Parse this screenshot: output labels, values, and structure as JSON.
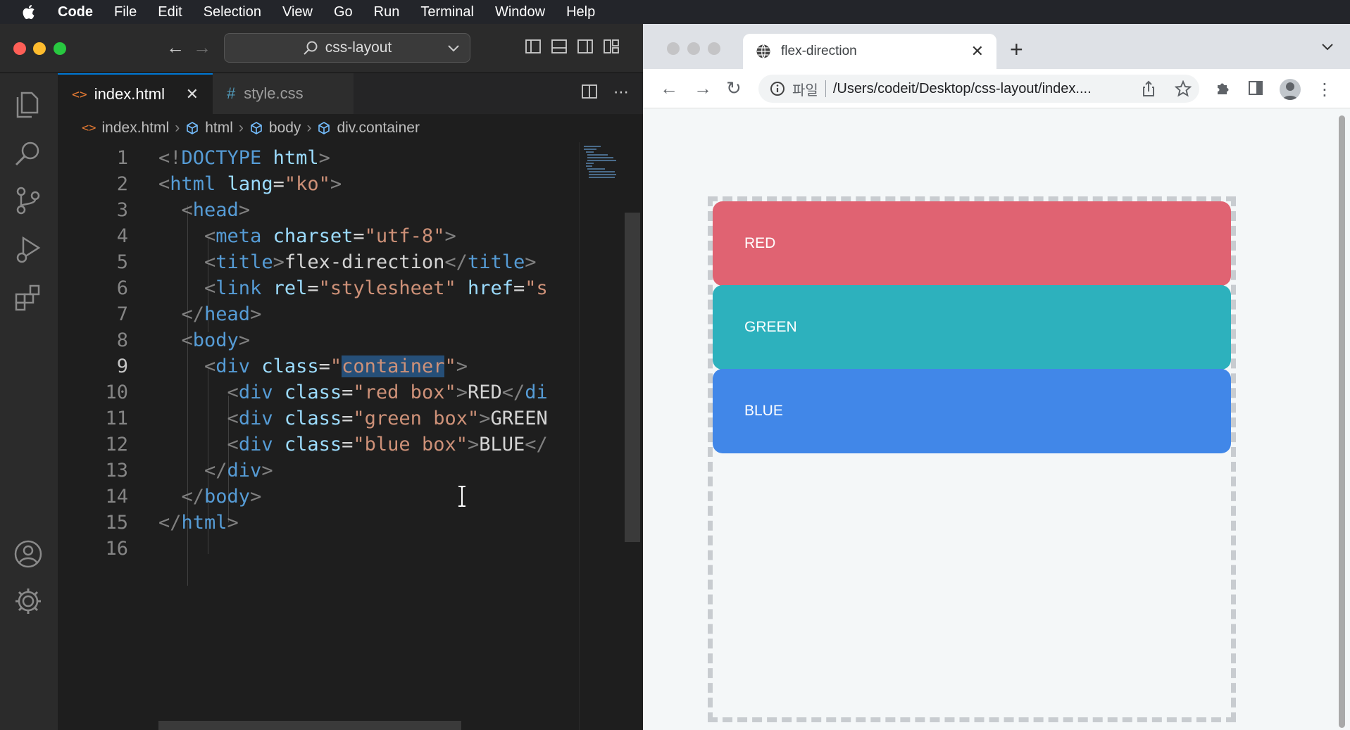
{
  "menubar": {
    "app": "Code",
    "items": [
      "File",
      "Edit",
      "Selection",
      "View",
      "Go",
      "Run",
      "Terminal",
      "Window",
      "Help"
    ]
  },
  "vscode": {
    "command_center": "css-layout",
    "tabs": [
      {
        "label": "index.html",
        "active": true,
        "icon": "html-file-icon"
      },
      {
        "label": "style.css",
        "active": false,
        "icon": "css-file-icon"
      }
    ],
    "breadcrumb": [
      "index.html",
      "html",
      "body",
      "div.container"
    ],
    "current_line": 9,
    "code_lines": [
      "1",
      "2",
      "3",
      "4",
      "5",
      "6",
      "7",
      "8",
      "9",
      "10",
      "11",
      "12",
      "13",
      "14",
      "15",
      "16"
    ],
    "colors": {
      "tab_accent": "#0078d4",
      "selection": "#264f78"
    }
  },
  "chrome": {
    "tab_title": "flex-direction",
    "omnibox_scheme": "파일",
    "omnibox_url": "/Users/codeit/Desktop/css-layout/index....",
    "boxes": [
      {
        "label": "RED",
        "color": "#e06372"
      },
      {
        "label": "GREEN",
        "color": "#2db1bd"
      },
      {
        "label": "BLUE",
        "color": "#4187e8"
      }
    ]
  }
}
